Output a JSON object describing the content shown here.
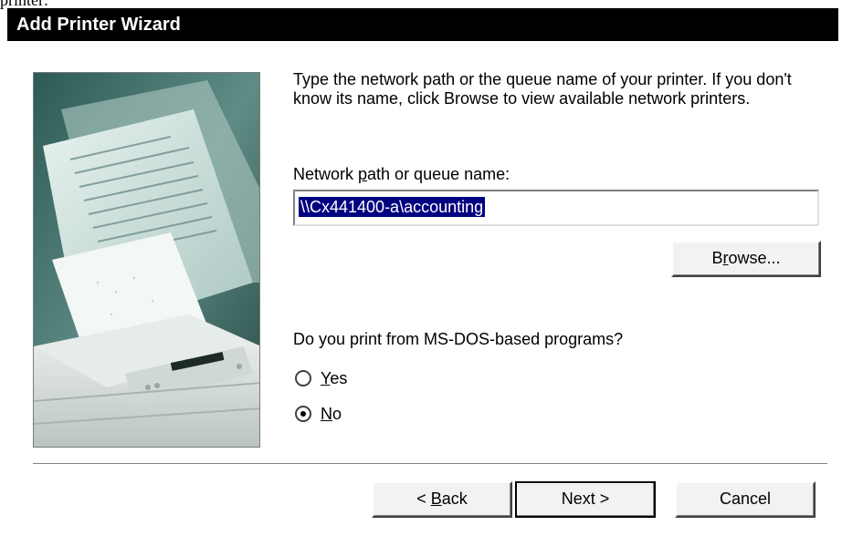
{
  "page_fragment": "printer:",
  "window": {
    "title": "Add Printer Wizard"
  },
  "illustration": {
    "name": "printer-illustration"
  },
  "instructions": "Type the network path or the queue name of your printer. If you don't know its name, click Browse to view available network printers.",
  "path_field": {
    "label_before": "Network ",
    "label_mnemonic": "p",
    "label_after": "ath or queue name:",
    "value": "\\\\Cx441400-a\\accounting"
  },
  "browse_button": {
    "before": "B",
    "mnemonic": "r",
    "after": "owse..."
  },
  "dos_question": "Do you print from MS-DOS-based programs?",
  "radios": [
    {
      "mnemonic": "Y",
      "rest": "es",
      "selected": false
    },
    {
      "mnemonic": "N",
      "rest": "o",
      "selected": true
    }
  ],
  "buttons": {
    "back": {
      "before": "< ",
      "mnemonic": "B",
      "after": "ack"
    },
    "next": "Next >",
    "cancel": "Cancel"
  },
  "colors": {
    "titlebar": "#000000",
    "selection": "#000080",
    "face": "#f2f2f2"
  }
}
